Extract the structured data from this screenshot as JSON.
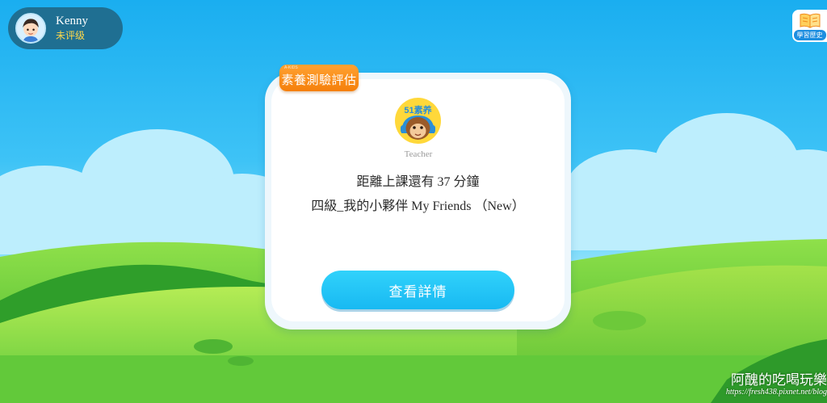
{
  "user": {
    "name": "Kenny",
    "level": "未评级"
  },
  "history": {
    "label": "學習歷史",
    "icon": "open-book-icon"
  },
  "card": {
    "tag_mini": "A-KIDS",
    "tag_label": "素養測驗評估",
    "logo_text": "51素养",
    "teacher_label": "Teacher",
    "countdown": "距離上課還有 37 分鐘",
    "lesson_title": "四級_我的小夥伴 My Friends （New）",
    "detail_button": "查看詳情"
  },
  "watermark": {
    "text": "阿醜的吃喝玩樂",
    "url": "https://fresh438.pixnet.net/blog"
  },
  "colors": {
    "sky": "#1aaef0",
    "grass": "#5cc83a",
    "accent_orange": "#f57f0a",
    "button_cyan": "#18b9f2",
    "user_pill": "#1f6f92",
    "level_yellow": "#ffd84a"
  }
}
